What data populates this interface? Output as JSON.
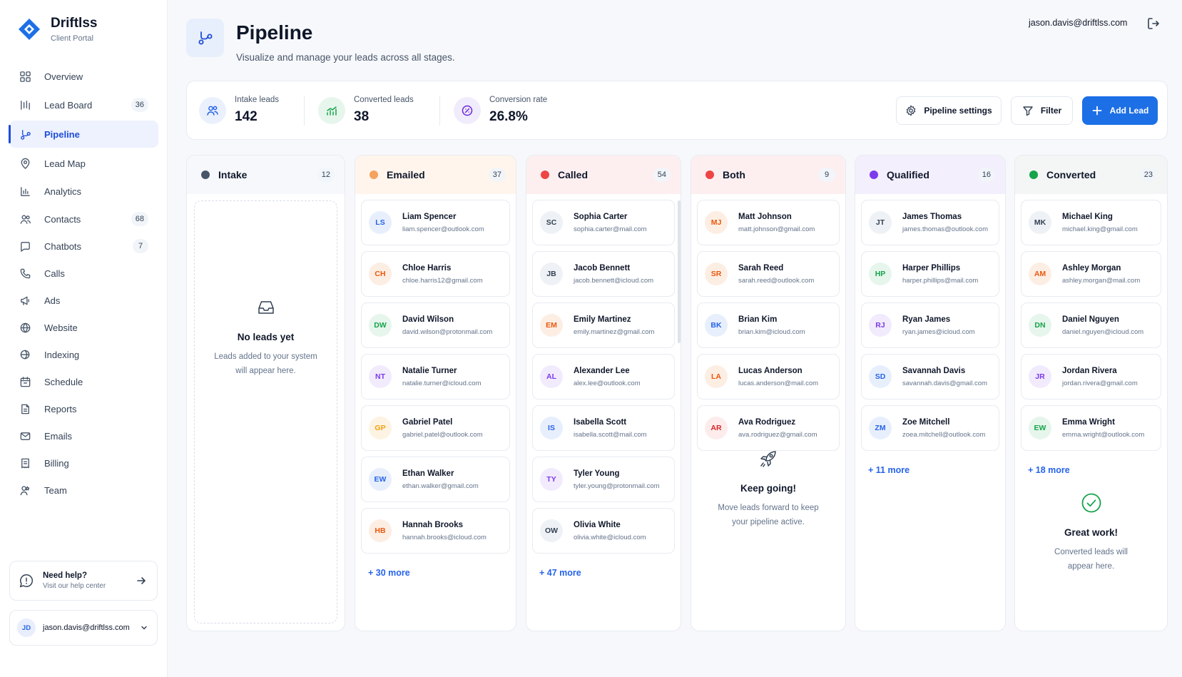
{
  "brand": {
    "name": "Driftlss",
    "subtitle": "Client Portal"
  },
  "sidebar": {
    "items": [
      {
        "label": "Overview",
        "icon": "grid-icon",
        "count": ""
      },
      {
        "label": "Lead Board",
        "icon": "board-icon",
        "count": "36"
      },
      {
        "label": "Pipeline",
        "icon": "pipeline-icon",
        "count": "",
        "active": true
      },
      {
        "label": "Lead Map",
        "icon": "map-pin-icon",
        "count": ""
      },
      {
        "label": "Analytics",
        "icon": "bar-chart-icon",
        "count": ""
      },
      {
        "label": "Contacts",
        "icon": "users-icon",
        "count": "68"
      },
      {
        "label": "Chatbots",
        "icon": "chat-icon",
        "count": "7"
      },
      {
        "label": "Calls",
        "icon": "phone-icon",
        "count": ""
      },
      {
        "label": "Ads",
        "icon": "megaphone-icon",
        "count": ""
      },
      {
        "label": "Website",
        "icon": "globe-icon",
        "count": ""
      },
      {
        "label": "Indexing",
        "icon": "globe-search-icon",
        "count": ""
      },
      {
        "label": "Schedule",
        "icon": "calendar-icon",
        "count": ""
      },
      {
        "label": "Reports",
        "icon": "report-icon",
        "count": ""
      },
      {
        "label": "Emails",
        "icon": "mail-icon",
        "count": ""
      },
      {
        "label": "Billing",
        "icon": "receipt-icon",
        "count": ""
      },
      {
        "label": "Team",
        "icon": "team-icon",
        "count": ""
      }
    ],
    "help": {
      "title": "Need help?",
      "subtitle": "Visit our help center"
    },
    "user": {
      "initials": "JD",
      "email": "jason.davis@driftlss.com"
    }
  },
  "header": {
    "title": "Pipeline",
    "subtitle": "Visualize and manage your leads across all stages.",
    "user_email": "jason.davis@driftlss.com"
  },
  "stats": [
    {
      "label": "Intake leads",
      "value": "142",
      "icon": "users-icon"
    },
    {
      "label": "Converted leads",
      "value": "38",
      "icon": "trend-up-icon"
    },
    {
      "label": "Conversion rate",
      "value": "26.8%",
      "icon": "target-icon"
    }
  ],
  "actions": {
    "settings": "Pipeline settings",
    "filter": "Filter",
    "add": "Add Lead"
  },
  "columns": [
    {
      "name": "Intake",
      "count": "12",
      "dot": "#475569",
      "tint": "#f6f8fb",
      "cards": [],
      "empty": {
        "title": "No leads yet",
        "text": "Leads added to your system will appear here."
      }
    },
    {
      "name": "Emailed",
      "count": "37",
      "dot": "#f5a25d",
      "tint": "#fff5ec",
      "cards": [
        {
          "initials": "LS",
          "name": "Liam Spencer",
          "email": "liam.spencer@outlook.com",
          "color": "#2563eb",
          "bg": "#e8effc"
        },
        {
          "initials": "CH",
          "name": "Chloe Harris",
          "email": "chloe.harris12@gmail.com",
          "color": "#ea580c",
          "bg": "#fdeee4"
        },
        {
          "initials": "DW",
          "name": "David Wilson",
          "email": "david.wilson@protonmail.com",
          "color": "#16a34a",
          "bg": "#e6f6ec"
        },
        {
          "initials": "NT",
          "name": "Natalie Turner",
          "email": "natalie.turner@icloud.com",
          "color": "#7c3aed",
          "bg": "#f1ebfd"
        },
        {
          "initials": "GP",
          "name": "Gabriel Patel",
          "email": "gabriel.patel@outlook.com",
          "color": "#f59e0b",
          "bg": "#fdf3e2"
        },
        {
          "initials": "EW",
          "name": "Ethan Walker",
          "email": "ethan.walker@gmail.com",
          "color": "#2563eb",
          "bg": "#e8effc"
        },
        {
          "initials": "HB",
          "name": "Hannah Brooks",
          "email": "hannah.brooks@icloud.com",
          "color": "#ea580c",
          "bg": "#fdeee4"
        }
      ],
      "more": "+ 30 more"
    },
    {
      "name": "Called",
      "count": "54",
      "dot": "#ef4444",
      "tint": "#fdeff0",
      "cards": [
        {
          "initials": "SC",
          "name": "Sophia Carter",
          "email": "sophia.carter@mail.com",
          "color": "#334155",
          "bg": "#eef1f5"
        },
        {
          "initials": "JB",
          "name": "Jacob Bennett",
          "email": "jacob.bennett@icloud.com",
          "color": "#334155",
          "bg": "#eef1f5"
        },
        {
          "initials": "EM",
          "name": "Emily Martinez",
          "email": "emily.martinez@gmail.com",
          "color": "#ea580c",
          "bg": "#fdeee4"
        },
        {
          "initials": "AL",
          "name": "Alexander Lee",
          "email": "alex.lee@outlook.com",
          "color": "#7c3aed",
          "bg": "#f1ebfd"
        },
        {
          "initials": "IS",
          "name": "Isabella Scott",
          "email": "isabella.scott@mail.com",
          "color": "#2563eb",
          "bg": "#e8effc"
        },
        {
          "initials": "TY",
          "name": "Tyler Young",
          "email": "tyler.young@protonmail.com",
          "color": "#7c3aed",
          "bg": "#f1ebfd"
        },
        {
          "initials": "OW",
          "name": "Olivia White",
          "email": "olivia.white@icloud.com",
          "color": "#334155",
          "bg": "#eef1f5"
        }
      ],
      "more": "+ 47 more"
    },
    {
      "name": "Both",
      "count": "9",
      "dot": "#ef4444",
      "tint": "#fdeff0",
      "cards": [
        {
          "initials": "MJ",
          "name": "Matt Johnson",
          "email": "matt.johnson@gmail.com",
          "color": "#ea580c",
          "bg": "#fdeee4"
        },
        {
          "initials": "SR",
          "name": "Sarah Reed",
          "email": "sarah.reed@outlook.com",
          "color": "#ea580c",
          "bg": "#fdeee4"
        },
        {
          "initials": "BK",
          "name": "Brian Kim",
          "email": "brian.kim@icloud.com",
          "color": "#2563eb",
          "bg": "#e8effc"
        },
        {
          "initials": "LA",
          "name": "Lucas Anderson",
          "email": "lucas.anderson@mail.com",
          "color": "#ea580c",
          "bg": "#fdeee4"
        },
        {
          "initials": "AR",
          "name": "Ava Rodriguez",
          "email": "ava.rodriguez@gmail.com",
          "color": "#dc2626",
          "bg": "#fdecec"
        }
      ],
      "more": "",
      "empty": {
        "title": "Keep going!",
        "text": "Move leads forward to keep your pipeline active."
      }
    },
    {
      "name": "Qualified",
      "count": "16",
      "dot": "#7c3aed",
      "tint": "#f3effd",
      "cards": [
        {
          "initials": "JT",
          "name": "James Thomas",
          "email": "james.thomas@outlook.com",
          "color": "#334155",
          "bg": "#eef1f5"
        },
        {
          "initials": "HP",
          "name": "Harper Phillips",
          "email": "harper.phillips@mail.com",
          "color": "#16a34a",
          "bg": "#e6f6ec"
        },
        {
          "initials": "RJ",
          "name": "Ryan James",
          "email": "ryan.james@icloud.com",
          "color": "#7c3aed",
          "bg": "#f1ebfd"
        },
        {
          "initials": "SD",
          "name": "Savannah Davis",
          "email": "savannah.davis@gmail.com",
          "color": "#2563eb",
          "bg": "#e8effc"
        },
        {
          "initials": "ZM",
          "name": "Zoe Mitchell",
          "email": "zoea.mitchell@outlook.com",
          "color": "#2563eb",
          "bg": "#e8effc"
        }
      ],
      "more": "+ 11 more"
    },
    {
      "name": "Converted",
      "count": "23",
      "dot": "#16a34a",
      "tint": "#f3f6f5",
      "cards": [
        {
          "initials": "MK",
          "name": "Michael King",
          "email": "michael.king@gmail.com",
          "color": "#334155",
          "bg": "#eef1f5"
        },
        {
          "initials": "AM",
          "name": "Ashley Morgan",
          "email": "ashley.morgan@mail.com",
          "color": "#ea580c",
          "bg": "#fdeee4"
        },
        {
          "initials": "DN",
          "name": "Daniel Nguyen",
          "email": "daniel.nguyen@icloud.com",
          "color": "#16a34a",
          "bg": "#e6f6ec"
        },
        {
          "initials": "JR",
          "name": "Jordan Rivera",
          "email": "jordan.rivera@gmail.com",
          "color": "#7c3aed",
          "bg": "#f1ebfd"
        },
        {
          "initials": "EW",
          "name": "Emma Wright",
          "email": "emma.wright@outlook.com",
          "color": "#16a34a",
          "bg": "#e6f6ec"
        }
      ],
      "more": "+ 18 more",
      "empty": {
        "title": "Great work!",
        "text": "Converted leads will appear here."
      }
    }
  ]
}
